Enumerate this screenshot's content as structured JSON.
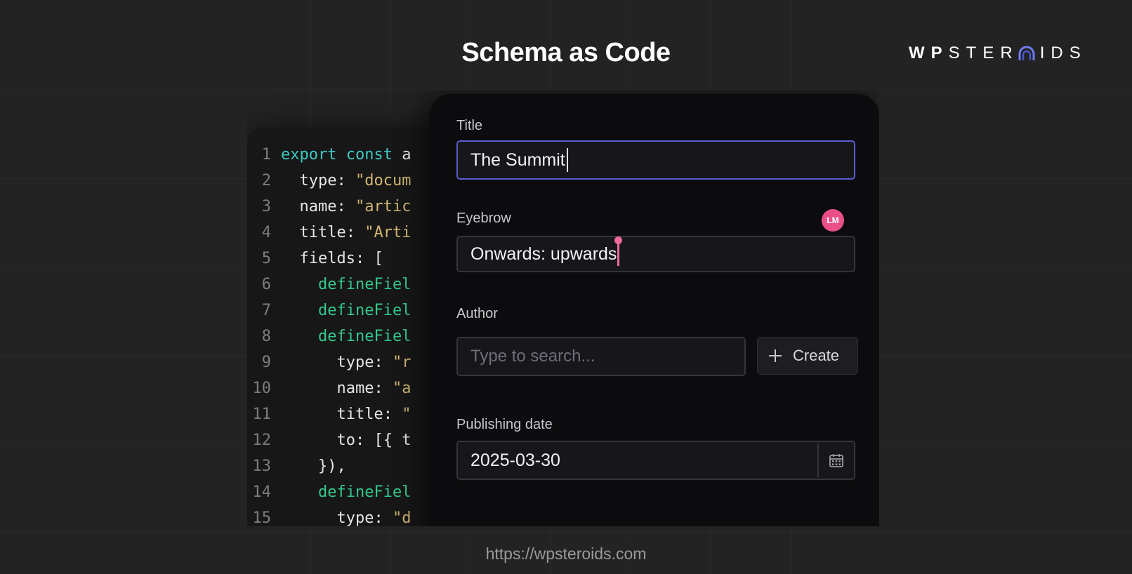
{
  "headline": "Schema as Code",
  "logo": {
    "text_a": "WP",
    "text_b": "STER",
    "text_c": "IDS"
  },
  "code": {
    "lines": [
      {
        "n": "1",
        "parts": [
          {
            "t": "export const",
            "c": "kw"
          },
          {
            "t": " a",
            "c": "plain"
          }
        ]
      },
      {
        "n": "2",
        "parts": [
          {
            "t": "  type",
            "c": "key"
          },
          {
            "t": ": ",
            "c": "plain"
          },
          {
            "t": "\"docum",
            "c": "str"
          }
        ]
      },
      {
        "n": "3",
        "parts": [
          {
            "t": "  name",
            "c": "key"
          },
          {
            "t": ": ",
            "c": "plain"
          },
          {
            "t": "\"artic",
            "c": "str"
          }
        ]
      },
      {
        "n": "4",
        "parts": [
          {
            "t": "  title",
            "c": "key"
          },
          {
            "t": ": ",
            "c": "plain"
          },
          {
            "t": "\"Arti",
            "c": "str"
          }
        ]
      },
      {
        "n": "5",
        "parts": [
          {
            "t": "  fields",
            "c": "key"
          },
          {
            "t": ": [",
            "c": "plain"
          }
        ]
      },
      {
        "n": "6",
        "parts": [
          {
            "t": "    defineFiel",
            "c": "fn"
          }
        ]
      },
      {
        "n": "7",
        "parts": [
          {
            "t": "    defineFiel",
            "c": "fn"
          }
        ]
      },
      {
        "n": "8",
        "parts": [
          {
            "t": "    defineFiel",
            "c": "fn"
          }
        ]
      },
      {
        "n": "9",
        "parts": [
          {
            "t": "      type",
            "c": "key"
          },
          {
            "t": ": ",
            "c": "plain"
          },
          {
            "t": "\"r",
            "c": "str"
          }
        ]
      },
      {
        "n": "10",
        "parts": [
          {
            "t": "      name",
            "c": "key"
          },
          {
            "t": ": ",
            "c": "plain"
          },
          {
            "t": "\"a",
            "c": "str"
          }
        ]
      },
      {
        "n": "11",
        "parts": [
          {
            "t": "      title",
            "c": "key"
          },
          {
            "t": ": ",
            "c": "plain"
          },
          {
            "t": "\"",
            "c": "str"
          }
        ]
      },
      {
        "n": "12",
        "parts": [
          {
            "t": "      to",
            "c": "key"
          },
          {
            "t": ": [{ t",
            "c": "plain"
          }
        ]
      },
      {
        "n": "13",
        "parts": [
          {
            "t": "    }),",
            "c": "plain"
          }
        ]
      },
      {
        "n": "14",
        "parts": [
          {
            "t": "    defineFiel",
            "c": "fn"
          }
        ]
      },
      {
        "n": "15",
        "parts": [
          {
            "t": "      type",
            "c": "key"
          },
          {
            "t": ": ",
            "c": "plain"
          },
          {
            "t": "\"d",
            "c": "str"
          }
        ]
      }
    ]
  },
  "form": {
    "title_label": "Title",
    "title_value": "The Summit",
    "eyebrow_label": "Eyebrow",
    "eyebrow_value": "Onwards: upwards",
    "collaborator_initials": "LM",
    "author_label": "Author",
    "author_placeholder": "Type to search...",
    "create_label": "Create",
    "date_label": "Publishing date",
    "date_value": "2025-03-30"
  },
  "footer_url": "https://wpsteroids.com",
  "colors": {
    "background": "#232323",
    "focus_border": "#5b5bd0",
    "collaborator": "#ea4f8a",
    "keyword": "#3ec8c2",
    "function": "#33c98e",
    "string": "#d1b672"
  },
  "icons": {
    "logo_o": "arch-icon",
    "create": "plus-icon",
    "date": "calendar-icon"
  }
}
